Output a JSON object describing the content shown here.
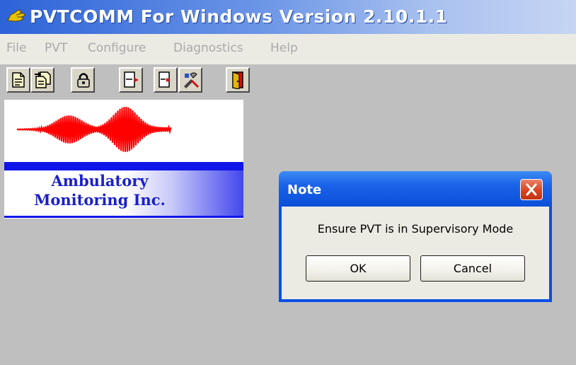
{
  "window": {
    "title": "PVTCOMM For Windows  Version 2.10.1.1",
    "icon": "app-hand-icon"
  },
  "menu": {
    "items": [
      "File",
      "PVT",
      "Configure",
      "Diagnostics",
      "Help"
    ]
  },
  "toolbar": {
    "buttons": [
      "new-document-icon",
      "copy-document-icon",
      "lock-icon",
      "download-icon",
      "upload-icon",
      "tools-icon",
      "exit-door-icon"
    ]
  },
  "logo": {
    "line1": "Ambulatory",
    "line2": "Monitoring Inc."
  },
  "dialog": {
    "title": "Note",
    "message": "Ensure PVT is in Supervisory Mode",
    "ok_label": "OK",
    "cancel_label": "Cancel"
  },
  "colors": {
    "titlebar": "#2d63d8",
    "desktop": "#bfbfbf",
    "dialog_frame": "#0a4ee8",
    "close_button": "#d9441f",
    "logo_blue": "#1016e8",
    "wave_red": "#ff0000"
  }
}
